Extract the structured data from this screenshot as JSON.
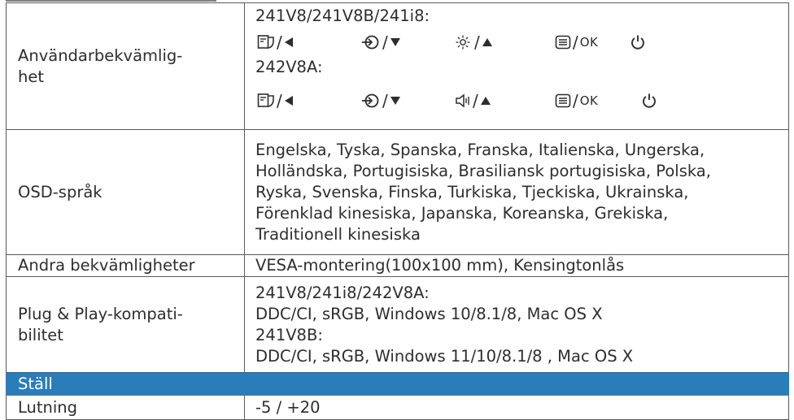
{
  "rows": {
    "convenience": {
      "label_line1": "Användarbekväml­ig-",
      "label_line2": "het",
      "model_group1": "241V8/241V8B/241i8:",
      "model_group2": "242V8A:",
      "ok_label": "OK",
      "icons_group1": [
        "osd-input-icon",
        "input-source-icon",
        "brightness-icon",
        "menu-icon",
        "power-icon"
      ],
      "icons_group2": [
        "osd-input-icon",
        "input-source-icon",
        "volume-icon",
        "menu-icon",
        "power-icon"
      ]
    },
    "osd": {
      "label": "OSD-språk",
      "lines": [
        "Engelska, Tyska, Spanska, Franska, Italienska, Ungerska,",
        "Holländska, Portugisiska, Brasiliansk portugisiska, Polska,",
        "Ryska, Svenska, Finska, Turkiska, Tjeckiska, Ukrainska,",
        "Förenklad kinesiska, Japanska, Koreanska, Grekiska,",
        "Traditionell kinesiska"
      ]
    },
    "other": {
      "label": "Andra bekvämligheter",
      "value": "VESA-montering(100x100 mm), Kensingtonlås"
    },
    "plugplay": {
      "label_line1": "Plug & Play-kompati-",
      "label_line2": "bilitet",
      "lines": [
        "241V8/241i8/242V8A:",
        "DDC/CI, sRGB, Windows 10/8.1/8, Mac OS X",
        "241V8B:",
        "DDC/CI, sRGB, Windows 11/10/8.1/8 , Mac OS X"
      ]
    },
    "stand_header": {
      "label": "Ställ"
    },
    "tilt": {
      "label": "Lutning",
      "value": "-5 / +20"
    }
  },
  "colors": {
    "section_header_bg": "#2a7db8",
    "text": "#2d2d2d",
    "border": "#5a5a5a"
  }
}
